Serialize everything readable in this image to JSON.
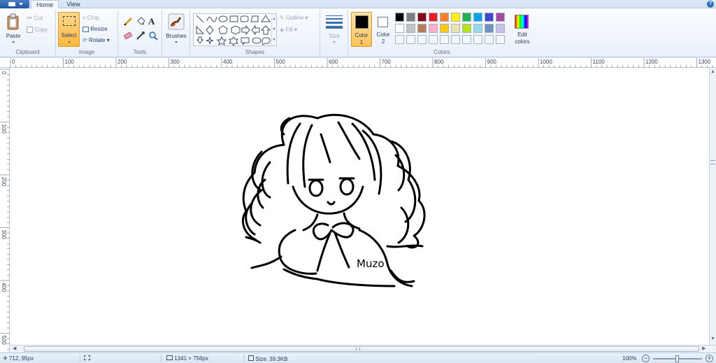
{
  "tabs": {
    "home": "Home",
    "view": "View"
  },
  "help_icon": "?",
  "clipboard": {
    "paste": "Paste",
    "cut": "Cut",
    "copy": "Copy",
    "label": "Clipboard"
  },
  "image": {
    "select": "Select",
    "crop": "Crop",
    "resize": "Resize",
    "rotate": "Rotate",
    "label": "Image"
  },
  "tools": {
    "label": "Tools",
    "text_tool": "A"
  },
  "brushes": {
    "label": "Brushes"
  },
  "shapes": {
    "label": "Shapes",
    "outline": "Outline",
    "fill": "Fill"
  },
  "size": {
    "label": "Size"
  },
  "colors": {
    "color1_label": "Color",
    "color1_num": "1",
    "color2_label": "Color",
    "color2_num": "2",
    "edit_label_1": "Edit",
    "edit_label_2": "colors",
    "label": "Colors",
    "color1_value": "#000000",
    "color2_value": "#ffffff",
    "palette_row1": [
      "#000000",
      "#7f7f7f",
      "#880015",
      "#ed1c24",
      "#ff7f27",
      "#fff200",
      "#22b14c",
      "#00a2e8",
      "#3f48cc",
      "#a349a4"
    ],
    "palette_row2": [
      "#ffffff",
      "#c3c3c3",
      "#b97a57",
      "#ffaec9",
      "#ffc90e",
      "#efe4b0",
      "#b5e61d",
      "#99d9ea",
      "#7092be",
      "#c8bfe7"
    ]
  },
  "ruler_h": [
    "0",
    "100",
    "200",
    "300",
    "400",
    "500",
    "600",
    "700",
    "800",
    "900",
    "1000",
    "1100",
    "1200",
    "1300"
  ],
  "ruler_v": [
    "0",
    "100",
    "200",
    "300",
    "400",
    "500"
  ],
  "signature": "Muzo",
  "status": {
    "cursor_pos": "712, 95px",
    "canvas_size": "1341 × 756px",
    "file_size": "Size: 39.3KB",
    "zoom": "100%"
  }
}
